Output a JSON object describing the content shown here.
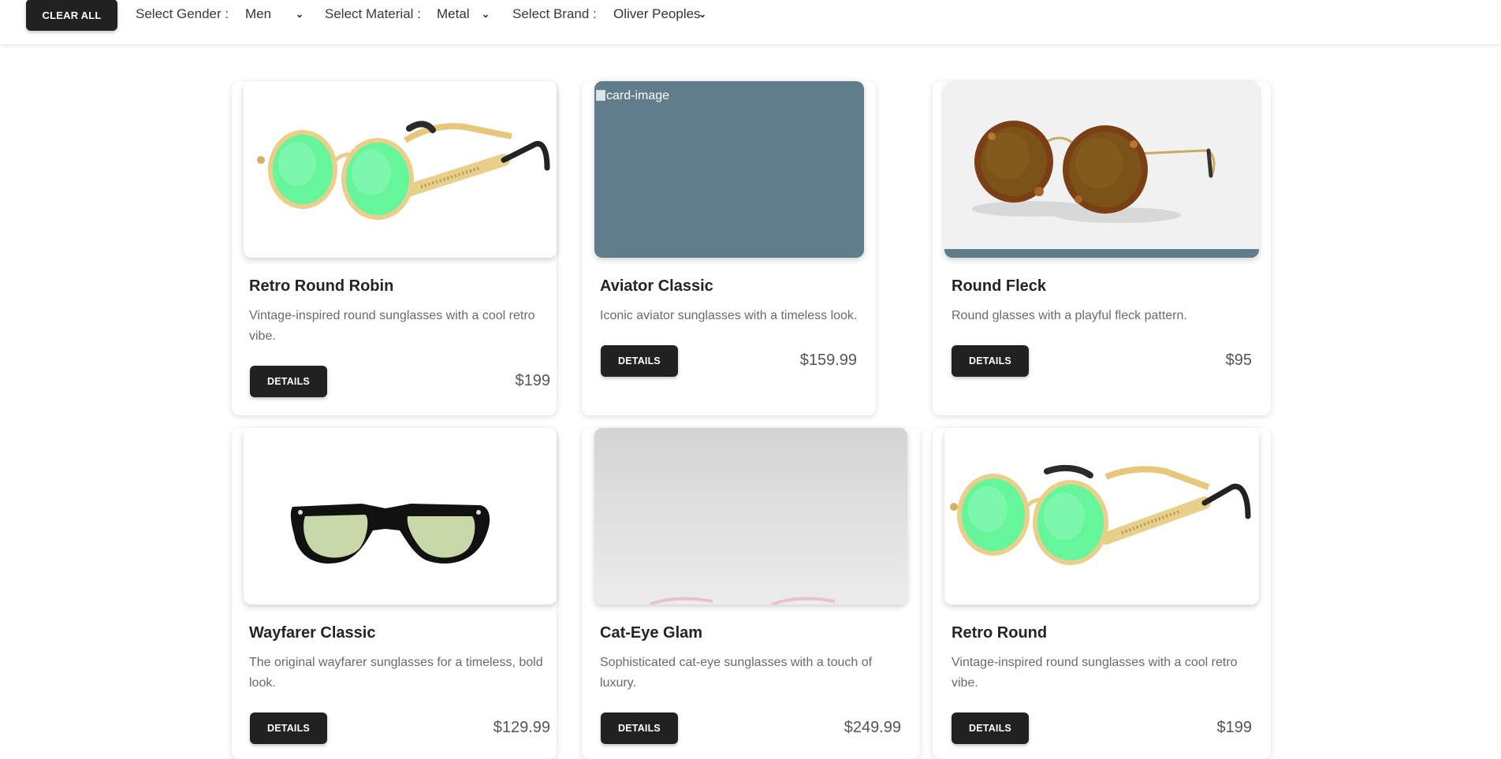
{
  "filters": {
    "clear_all": "CLEAR ALL",
    "gender_label": "Select Gender :",
    "gender_value": "Men",
    "material_label": "Select Material :",
    "material_value": "Metal",
    "brand_label": "Select Brand :",
    "brand_value": "Oliver Peoples"
  },
  "products": [
    {
      "title": "Retro Round Robin",
      "description": "Vintage-inspired round sunglasses with a cool retro vibe.",
      "button": "DETAILS",
      "price": "$199",
      "image": "steampunk-round-green-sunglasses"
    },
    {
      "title": "Aviator Classic",
      "description": "Iconic aviator sunglasses with a timeless look.",
      "button": "DETAILS",
      "price": "$159.99",
      "image": "broken-image",
      "image_alt": "card-image"
    },
    {
      "title": "Round Fleck",
      "description": "Round glasses with a playful fleck pattern.",
      "button": "DETAILS",
      "price": "$95",
      "image": "tortoise-round-brown-sunglasses"
    },
    {
      "title": "Wayfarer Classic",
      "description": "The original wayfarer sunglasses for a timeless, bold look.",
      "button": "DETAILS",
      "price": "$129.99",
      "image": "black-wayfarer-green-lens-sunglasses"
    },
    {
      "title": "Cat-Eye Glam",
      "description": "Sophisticated cat-eye sunglasses with a touch of luxury.",
      "button": "DETAILS",
      "price": "$249.99",
      "image": "cat-eye-sunglasses-grey-backdrop"
    },
    {
      "title": "Retro Round",
      "description": "Vintage-inspired round sunglasses with a cool retro vibe.",
      "button": "DETAILS",
      "price": "$199",
      "image": "steampunk-round-green-sunglasses"
    }
  ],
  "colors": {
    "button_bg": "#212121",
    "broken_image_bg": "#607d8b",
    "lens_green": "#66f59b",
    "gold_frame": "#e8cf8a"
  }
}
